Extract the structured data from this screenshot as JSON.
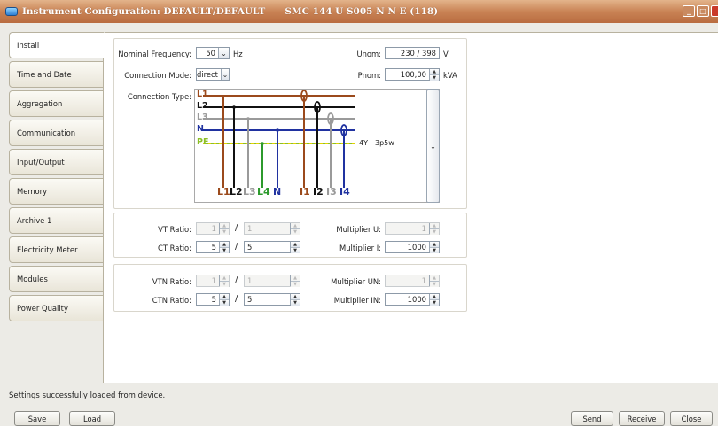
{
  "window": {
    "title": "Instrument Configuration: DEFAULT/DEFAULT",
    "device": "SMC 144 U S005 N N E (118)"
  },
  "tabs": [
    {
      "label": "Install"
    },
    {
      "label": "Time and Date"
    },
    {
      "label": "Aggregation"
    },
    {
      "label": "Communication"
    },
    {
      "label": "Input/Output"
    },
    {
      "label": "Memory"
    },
    {
      "label": "Archive 1"
    },
    {
      "label": "Electricity Meter"
    },
    {
      "label": "Modules"
    },
    {
      "label": "Power Quality"
    }
  ],
  "install": {
    "nominal_frequency": {
      "label": "Nominal Frequency:",
      "value": "50",
      "unit": "Hz"
    },
    "connection_mode": {
      "label": "Connection Mode:",
      "value": "direct"
    },
    "connection_type": {
      "label": "Connection Type:",
      "code": "4Y",
      "name": "3p5w",
      "lines": [
        "L1",
        "L2",
        "L3",
        "N",
        "PE"
      ],
      "bottom_labels": [
        "L1",
        "L2",
        "L3",
        "L4",
        "N",
        "I1",
        "I2",
        "I3",
        "I4"
      ]
    },
    "unom": {
      "label": "Unom:",
      "value": "230 / 398",
      "unit": "V"
    },
    "pnom": {
      "label": "Pnom:",
      "value": "100,00",
      "unit": "kVA"
    }
  },
  "ratios": {
    "vt": {
      "label": "VT Ratio:",
      "primary": "1",
      "secondary": "1"
    },
    "ct": {
      "label": "CT Ratio:",
      "primary": "5",
      "secondary": "5"
    },
    "multiplier_u": {
      "label": "Multiplier U:",
      "value": "1"
    },
    "multiplier_i": {
      "label": "Multiplier I:",
      "value": "1000"
    }
  },
  "neutral": {
    "vtn": {
      "label": "VTN Ratio:",
      "primary": "1",
      "secondary": "1"
    },
    "ctn": {
      "label": "CTN Ratio:",
      "primary": "5",
      "secondary": "5"
    },
    "multiplier_un": {
      "label": "Multiplier UN:",
      "value": "1"
    },
    "multiplier_in": {
      "label": "Multiplier IN:",
      "value": "1000"
    }
  },
  "status": "Settings successfully loaded from device.",
  "buttons": {
    "save": "Save",
    "load": "Load",
    "send": "Send",
    "receive": "Receive",
    "close": "Close"
  },
  "colors": {
    "l1": "#9b4a1c",
    "l2": "#111111",
    "l3": "#9a9a9a",
    "n": "#2032a0",
    "pe": "#8cbf26",
    "title_bar": "#c98355"
  }
}
